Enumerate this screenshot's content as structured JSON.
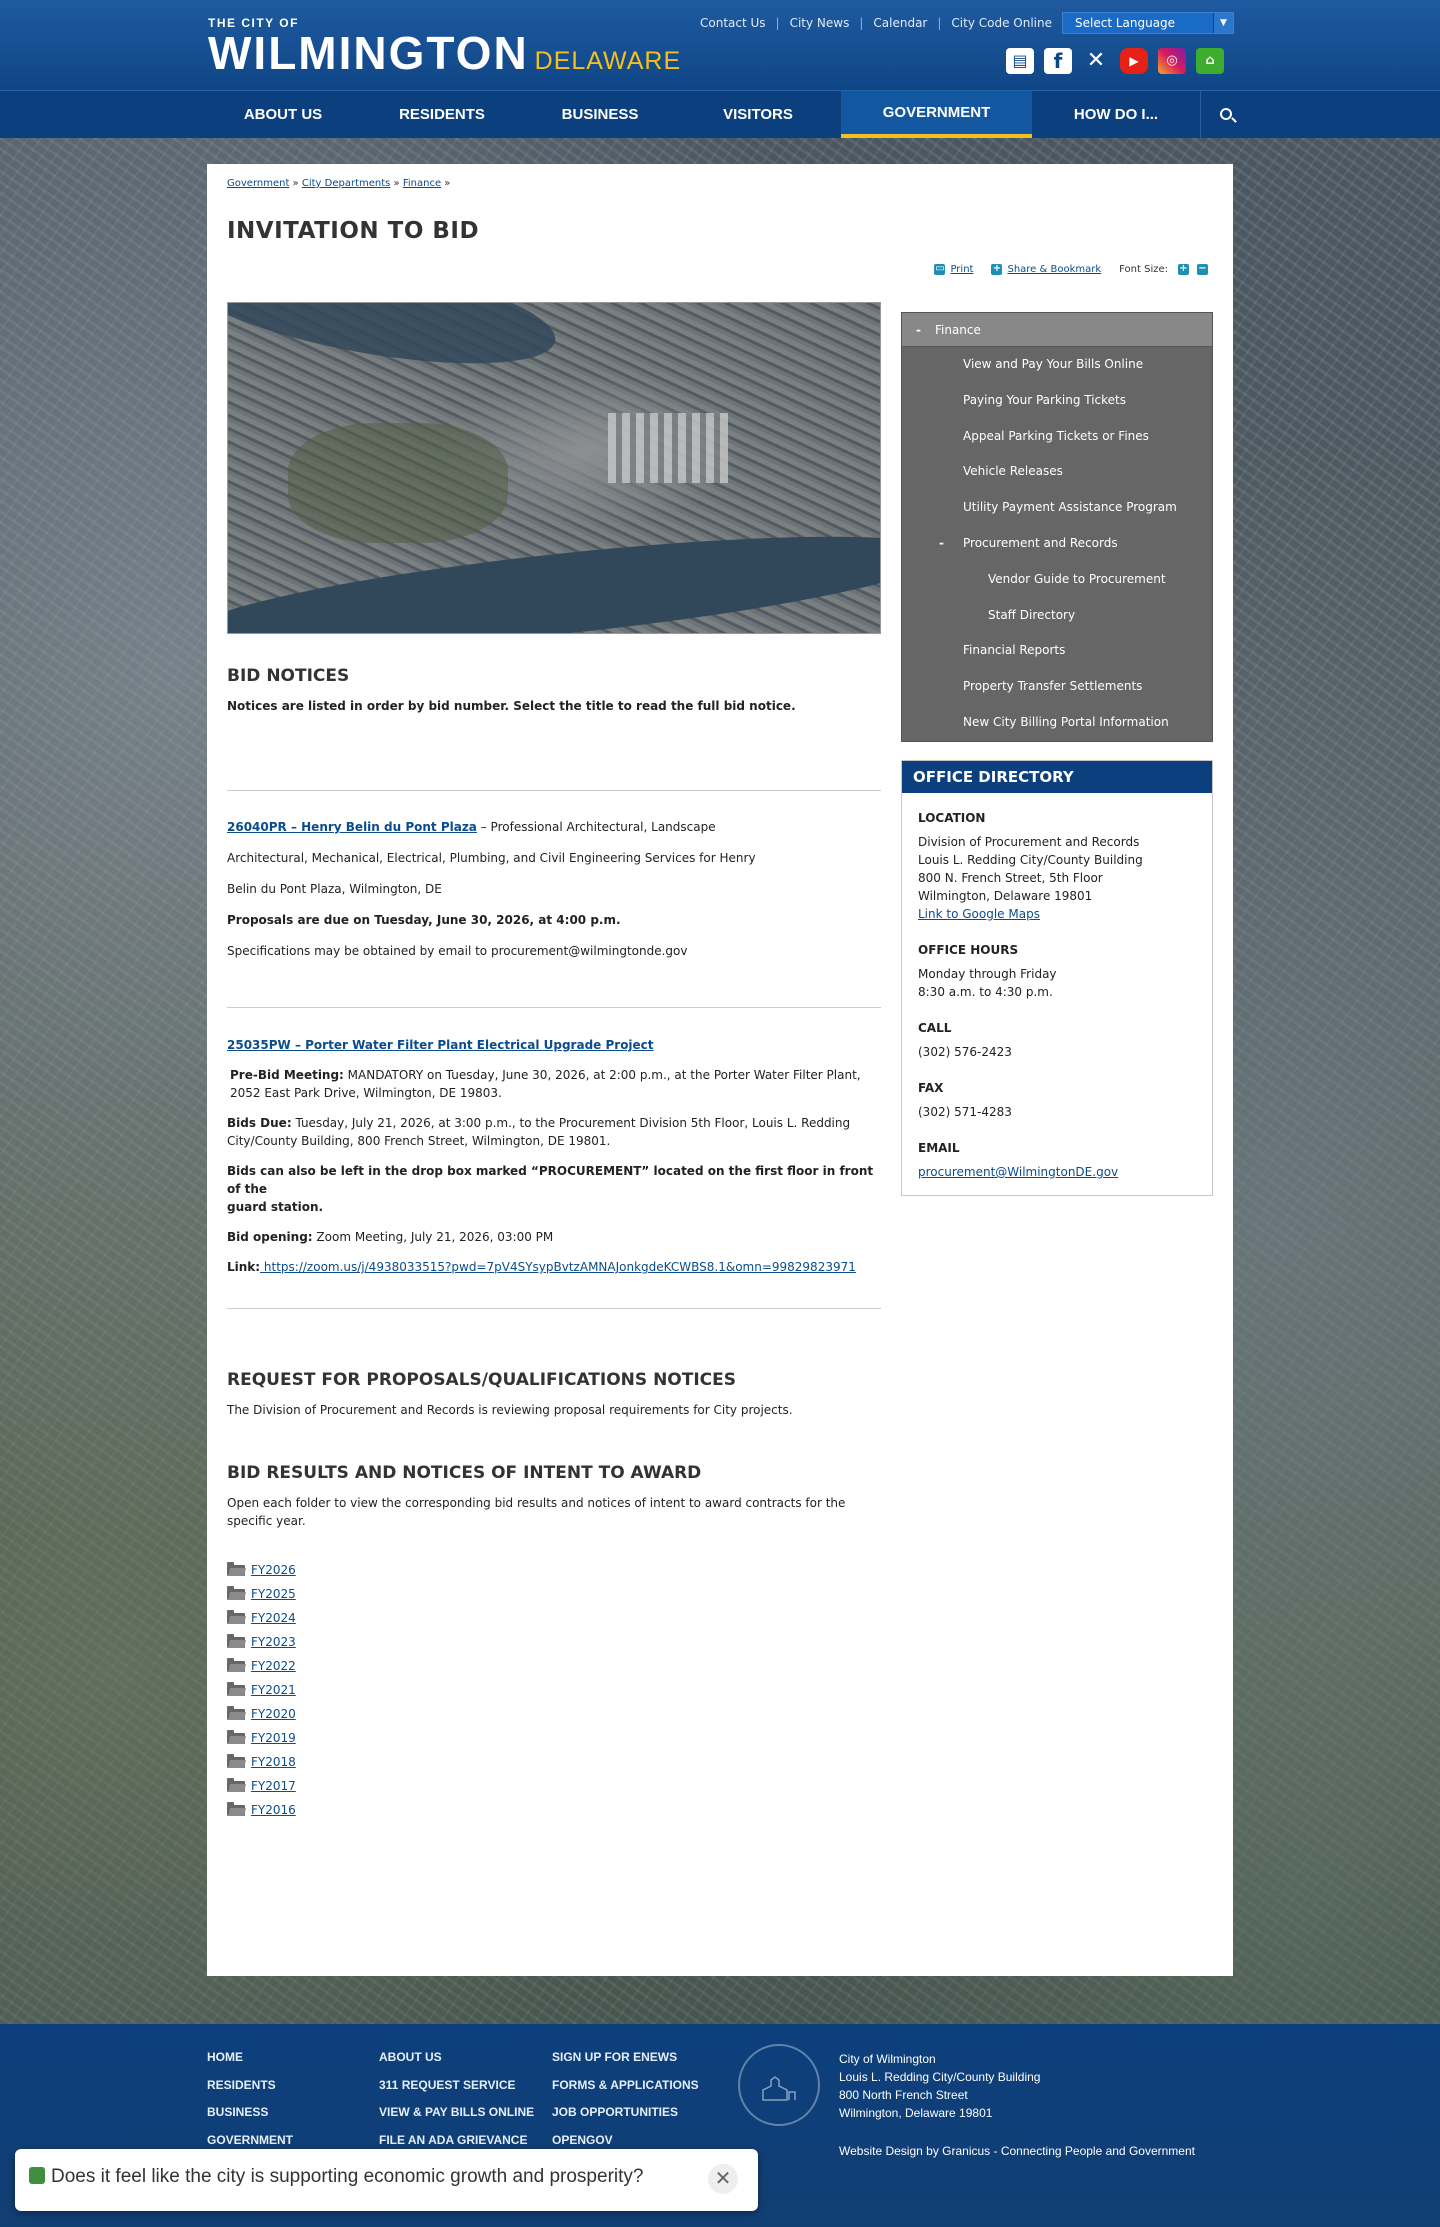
{
  "header": {
    "logo_top": "THE CITY OF",
    "logo_city": "WILMINGTON",
    "logo_state": "DELAWARE",
    "top_links": [
      "Contact Us",
      "City News",
      "Calendar",
      "City Code Online"
    ],
    "language_select": "Select Language",
    "social_icons": [
      "news-icon",
      "facebook-icon",
      "x-icon",
      "youtube-icon",
      "instagram-icon",
      "nextdoor-icon"
    ]
  },
  "nav": {
    "items": [
      "ABOUT US",
      "RESIDENTS",
      "BUSINESS",
      "VISITORS",
      "GOVERNMENT",
      "HOW DO I..."
    ],
    "active": "GOVERNMENT"
  },
  "breadcrumb": [
    "Government",
    "City Departments",
    "Finance"
  ],
  "page_title": "INVITATION TO BID",
  "tools": {
    "print": "Print",
    "share": "Share & Bookmark",
    "font_size": "Font Size:"
  },
  "bid_notices": {
    "heading": "BID NOTICES",
    "intro": "Notices are listed in order by bid number. Select the title to read the full bid notice.",
    "notice1": {
      "link": "26040PR – Henry Belin du Pont Plaza",
      "desc1": " – Professional Architectural, Landscape",
      "desc2": "Architectural, Mechanical, Electrical, Plumbing, and Civil Engineering Services for Henry",
      "desc3": "Belin du Pont Plaza, Wilmington, DE",
      "due": "Proposals are due on Tuesday, June 30, 2026, at 4:00 p.m.",
      "spec": "Specifications may be obtained by email to procurement@wilmingtonde.gov"
    },
    "notice2": {
      "link": "25035PW – Porter Water Filter Plant Electrical Upgrade Project",
      "prebid_label": "Pre-Bid Meeting:",
      "prebid_line1": " MANDATORY on Tuesday, June 30, 2026, at 2:00 p.m., at the Porter Water Filter Plant,",
      "prebid_line2": "2052 East Park Drive, Wilmington, DE 19803.",
      "bidsdue_label": "Bids Due:",
      "bidsdue_line1": " Tuesday, July 21, 2026, at 3:00 p.m., to the Procurement Division 5th Floor, Louis L. Redding",
      "bidsdue_line2": "City/County Building, 800 French Street, Wilmington, DE 19801.",
      "dropbox_line1": "Bids can also be left in the drop box marked “PROCUREMENT” located on the first floor in front of the",
      "dropbox_line2": "guard station.",
      "opening_label": "Bid opening:",
      "opening_value": " Zoom Meeting, July 21, 2026, 03:00 PM",
      "link_label": "Link:",
      "zoom_link": " https://zoom.us/j/4938033515?pwd=7pV4SYsypBvtzAMNAJonkgdeKCWBS8.1&omn=99829823971"
    }
  },
  "rfp": {
    "heading": "REQUEST FOR PROPOSALS/QUALIFICATIONS NOTICES",
    "text": "The Division of Procurement and Records is reviewing proposal requirements for City projects."
  },
  "results": {
    "heading": "BID RESULTS AND NOTICES OF INTENT TO AWARD",
    "text1": "Open each folder to view the corresponding bid results and notices of intent to award contracts for the",
    "text2": "specific year.",
    "folders": [
      "FY2026",
      "FY2025",
      "FY2024",
      "FY2023",
      "FY2022",
      "FY2021",
      "FY2020",
      "FY2019",
      "FY2018",
      "FY2017",
      "FY2016"
    ]
  },
  "sidenav": {
    "head_toggle": "-",
    "head": "Finance",
    "items": [
      "View and Pay Your Bills Online",
      "Paying Your Parking Tickets",
      "Appeal Parking Tickets or Fines",
      "Vehicle Releases",
      "Utility Payment Assistance Program"
    ],
    "open_toggle": "-",
    "open_item": "Procurement and Records",
    "sub_items": [
      "Vendor Guide to Procurement",
      "Staff Directory"
    ],
    "items_after": [
      "Financial Reports",
      "Property Transfer Settlements",
      "New City Billing Portal Information"
    ]
  },
  "directory": {
    "heading": "OFFICE DIRECTORY",
    "location_label": "LOCATION",
    "location_lines": [
      "Division of Procurement and Records",
      "Louis L. Redding City/County Building",
      "800 N. French Street, 5th Floor",
      "Wilmington, Delaware 19801"
    ],
    "map_link": "Link to Google Maps",
    "hours_label": "OFFICE HOURS",
    "hours_lines": [
      "Monday through Friday",
      "8:30 a.m. to 4:30 p.m."
    ],
    "call_label": "CALL",
    "call": "(302) 576-2423",
    "fax_label": "FAX",
    "fax": "(302) 571-4283",
    "email_label": "EMAIL",
    "email": "procurement@WilmingtonDE.gov"
  },
  "footer": {
    "col1": [
      "HOME",
      "RESIDENTS",
      "BUSINESS",
      "GOVERNMENT"
    ],
    "col2": [
      "ABOUT US",
      "311 REQUEST SERVICE",
      "VIEW & PAY BILLS ONLINE",
      "FILE AN ADA GRIEVANCE"
    ],
    "col3": [
      "SIGN UP FOR ENEWS",
      "FORMS & APPLICATIONS",
      "JOB OPPORTUNITIES",
      "OPENGOV"
    ],
    "address": [
      "City of Wilmington",
      "Louis L. Redding City/County Building",
      "800 North French Street",
      "Wilmington, Delaware 19801"
    ],
    "credit": "Website Design by Granicus - Connecting People and Government"
  },
  "survey": {
    "question": "Does it feel like the city is supporting economic growth and prosperity?"
  }
}
